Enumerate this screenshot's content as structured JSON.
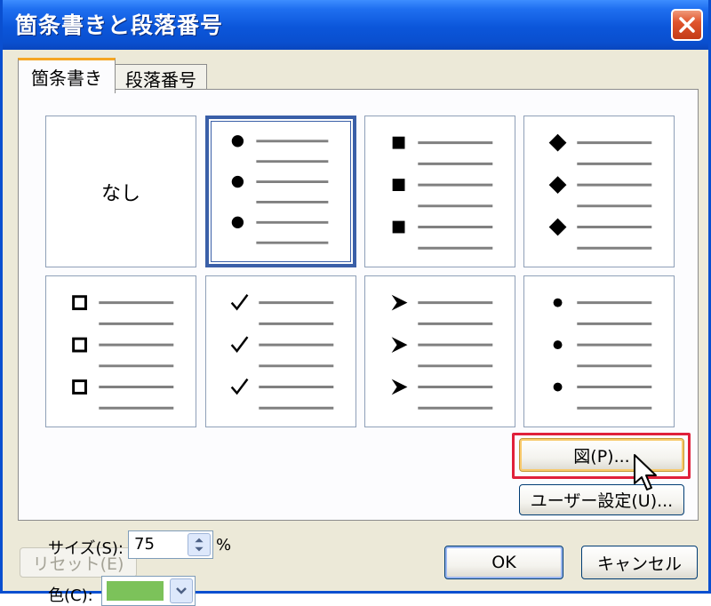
{
  "window": {
    "title": "箇条書きと段落番号"
  },
  "tabs": [
    {
      "label": "箇条書き",
      "active": true
    },
    {
      "label": "段落番号",
      "active": false
    }
  ],
  "bullet_styles": [
    {
      "id": "none",
      "label": "なし",
      "symbol": "none"
    },
    {
      "id": "filled-circle",
      "symbol": "circle",
      "selected": true
    },
    {
      "id": "filled-square",
      "symbol": "square"
    },
    {
      "id": "filled-diamond",
      "symbol": "diamond"
    },
    {
      "id": "hollow-square",
      "symbol": "hollow-square"
    },
    {
      "id": "checkmark",
      "symbol": "check"
    },
    {
      "id": "arrowhead",
      "symbol": "arrow"
    },
    {
      "id": "small-dot",
      "symbol": "dot"
    }
  ],
  "size": {
    "label": "サイズ(S):",
    "value": "75",
    "unit": "%"
  },
  "color": {
    "label": "色(C):",
    "value": "#7cc25a"
  },
  "buttons": {
    "picture": "図(P)...",
    "customize": "ユーザー設定(U)...",
    "reset": "リセット(E)",
    "ok": "OK",
    "cancel": "キャンセル"
  },
  "colors": {
    "titlebar": "#0a4fcf",
    "highlight": "#e0203a",
    "selection": "#3a5fa8"
  }
}
